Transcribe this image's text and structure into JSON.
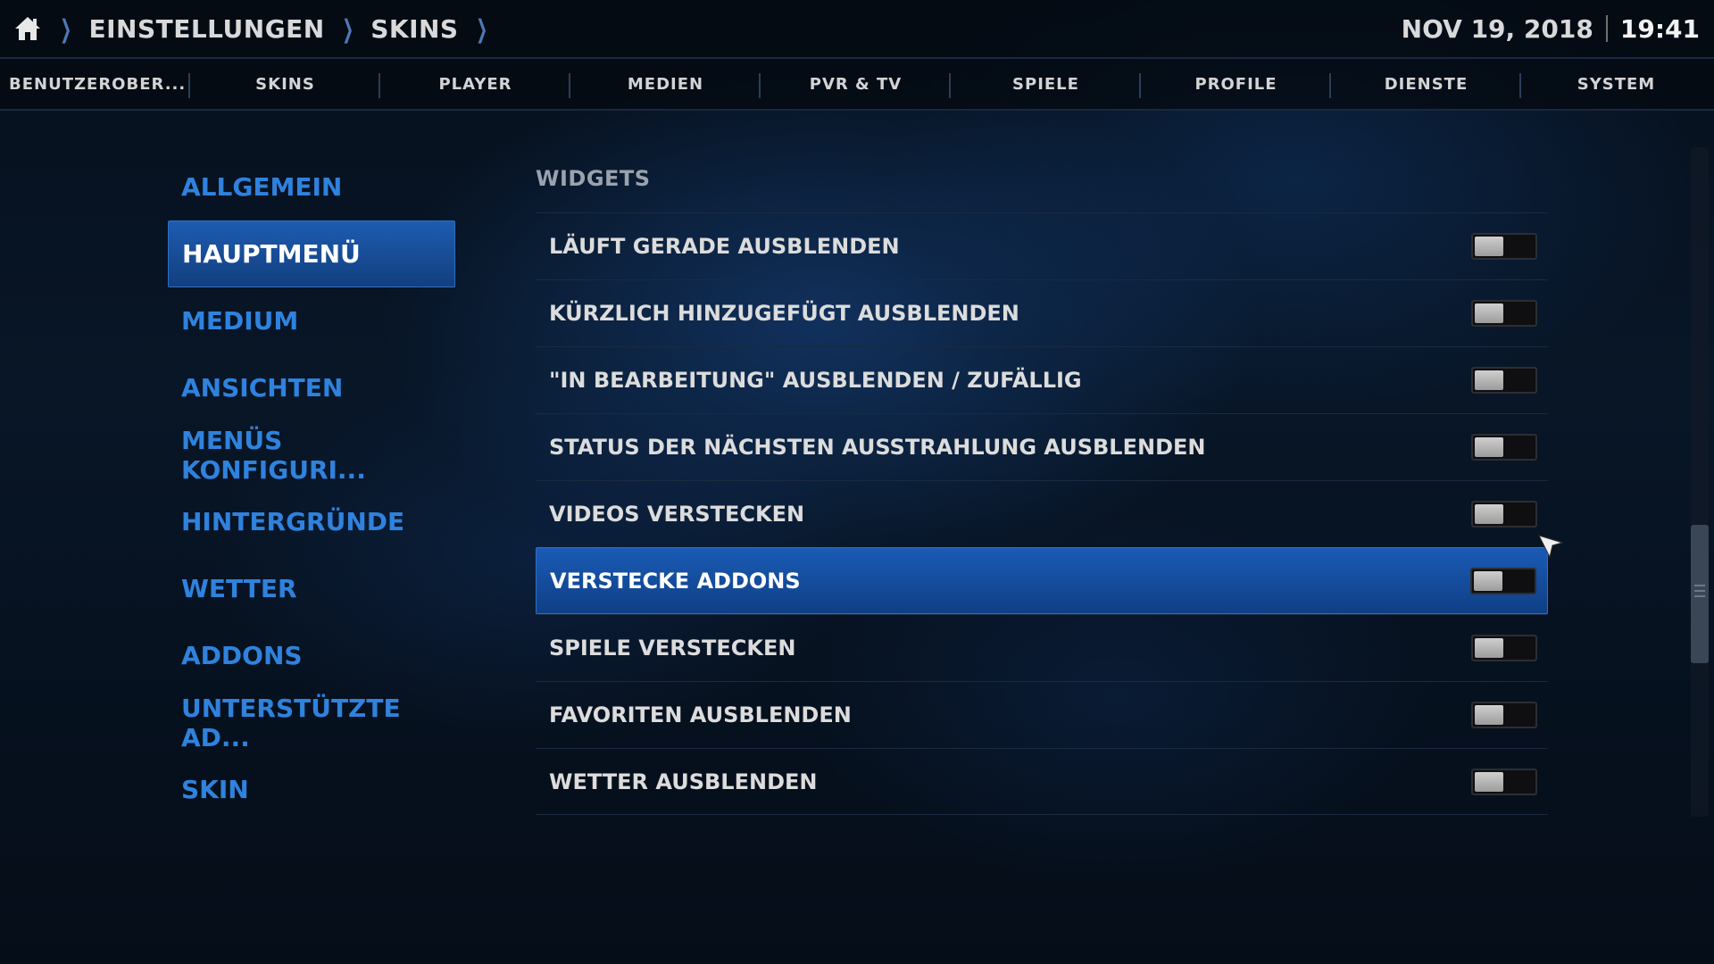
{
  "header": {
    "home_icon": "home-icon",
    "breadcrumbs": [
      "EINSTELLUNGEN",
      "SKINS"
    ],
    "date": "NOV 19, 2018",
    "time": "19:41"
  },
  "tabs": [
    "BENUTZEROBER...",
    "SKINS",
    "PLAYER",
    "MEDIEN",
    "PVR & TV",
    "SPIELE",
    "PROFILE",
    "DIENSTE",
    "SYSTEM"
  ],
  "left_menu": {
    "items": [
      "ALLGEMEIN",
      "HAUPTMENÜ",
      "MEDIUM",
      "ANSICHTEN",
      "MENÜS KONFIGURI...",
      "HINTERGRÜNDE",
      "WETTER",
      "ADDONS",
      "UNTERSTÜTZTE AD...",
      "SKIN"
    ],
    "active_index": 1
  },
  "panel": {
    "section_title": "WIDGETS",
    "rows": [
      {
        "label": "LÄUFT GERADE AUSBLENDEN",
        "enabled": false
      },
      {
        "label": "KÜRZLICH HINZUGEFÜGT AUSBLENDEN",
        "enabled": false
      },
      {
        "label": "\"IN BEARBEITUNG\" AUSBLENDEN / ZUFÄLLIG",
        "enabled": false
      },
      {
        "label": "STATUS DER NÄCHSTEN AUSSTRAHLUNG AUSBLENDEN",
        "enabled": false
      },
      {
        "label": "VIDEOS VERSTECKEN",
        "enabled": false
      },
      {
        "label": "VERSTECKE ADDONS",
        "enabled": false
      },
      {
        "label": "SPIELE VERSTECKEN",
        "enabled": false
      },
      {
        "label": "FAVORITEN AUSBLENDEN",
        "enabled": false
      },
      {
        "label": "WETTER AUSBLENDEN",
        "enabled": false
      }
    ],
    "focused_index": 5
  },
  "colors": {
    "accent": "#2f82dd",
    "focus_bg": "#1a5bb5",
    "background": "#081627"
  }
}
